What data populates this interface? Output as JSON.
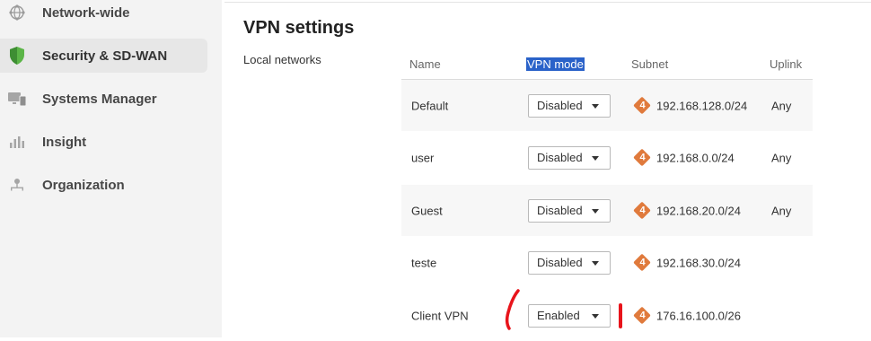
{
  "sidebar": {
    "items": [
      {
        "label": "Network-wide",
        "icon": "globe-icon",
        "active": false
      },
      {
        "label": "Security & SD-WAN",
        "icon": "shield-icon",
        "active": true
      },
      {
        "label": "Systems Manager",
        "icon": "devices-icon",
        "active": false
      },
      {
        "label": "Insight",
        "icon": "bar-chart-icon",
        "active": false
      },
      {
        "label": "Organization",
        "icon": "org-icon",
        "active": false
      }
    ]
  },
  "main": {
    "title": "VPN settings",
    "section_label": "Local networks",
    "table": {
      "headers": {
        "name": "Name",
        "vpn_mode": "VPN mode",
        "subnet": "Subnet",
        "uplink": "Uplink"
      },
      "rows": [
        {
          "name": "Default",
          "mode": "Disabled",
          "badge": "4",
          "subnet": "192.168.128.0/24",
          "uplink": "Any"
        },
        {
          "name": "user",
          "mode": "Disabled",
          "badge": "4",
          "subnet": "192.168.0.0/24",
          "uplink": "Any"
        },
        {
          "name": "Guest",
          "mode": "Disabled",
          "badge": "4",
          "subnet": "192.168.20.0/24",
          "uplink": "Any"
        },
        {
          "name": "teste",
          "mode": "Disabled",
          "badge": "4",
          "subnet": "192.168.30.0/24",
          "uplink": ""
        },
        {
          "name": "Client VPN",
          "mode": "Enabled",
          "badge": "4",
          "subnet": "176.16.100.0/26",
          "uplink": ""
        }
      ]
    }
  },
  "colors": {
    "accent_highlight": "#2a62c9",
    "badge": "#e07a3c",
    "shield_green": "#5bb547",
    "annotation_red": "#e8141b"
  }
}
